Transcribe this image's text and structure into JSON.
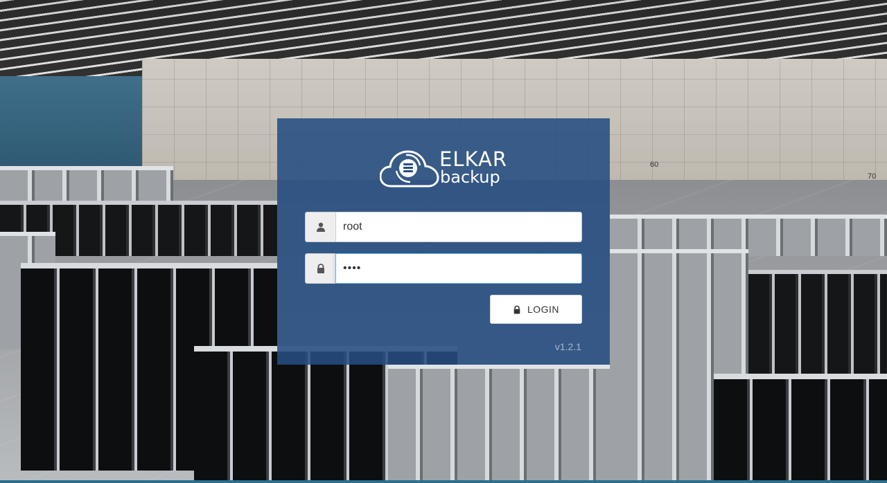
{
  "logo": {
    "title": "ELKAR",
    "subtitle": "backup"
  },
  "background": {
    "wall_numbers": [
      "60",
      "70"
    ]
  },
  "form": {
    "username": {
      "value": "root",
      "icon": "user-icon"
    },
    "password": {
      "value": "••••",
      "icon": "lock-icon"
    },
    "login_button": {
      "label": "LOGIN",
      "icon": "lock-icon"
    }
  },
  "version": "v1.2.1",
  "colors": {
    "panel": "#254d82",
    "button_bg": "#ffffff",
    "focus_border": "#66afe9",
    "version_text": "#a9b7c9"
  }
}
